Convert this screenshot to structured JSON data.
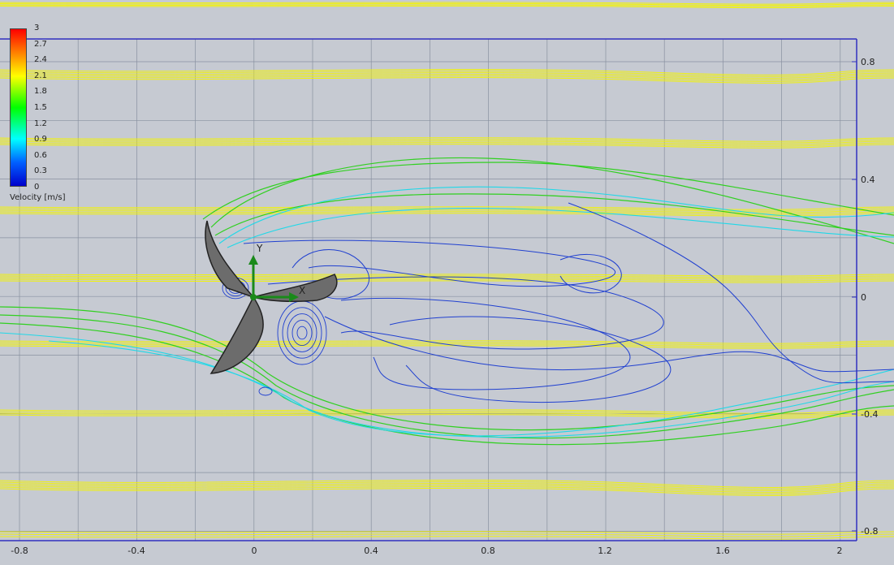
{
  "legend": {
    "title": "Velocity [m/s]",
    "ticks": [
      "3",
      "2.7",
      "2.4",
      "2.1",
      "1.8",
      "1.5",
      "1.2",
      "0.9",
      "0.6",
      "0.3",
      "0"
    ]
  },
  "axes": {
    "x_ticks": [
      "-0.8",
      "-0.4",
      "0",
      "0.4",
      "0.8",
      "1.2",
      "1.6",
      "2"
    ],
    "y_ticks": [
      "0.8",
      "0.4",
      "0",
      "-0.4",
      "-0.8"
    ],
    "triad_x_label": "X",
    "triad_y_label": "Y"
  },
  "colors": {
    "background": "#c6cad2",
    "grid": "#8890a0",
    "axis": "#3030c0",
    "fast_flow": "#f4f400",
    "medium_flow": "#30d020",
    "slow_flow": "#20d8e8",
    "vortex_flow": "#2040d0",
    "blade": "#6c6c6c"
  }
}
